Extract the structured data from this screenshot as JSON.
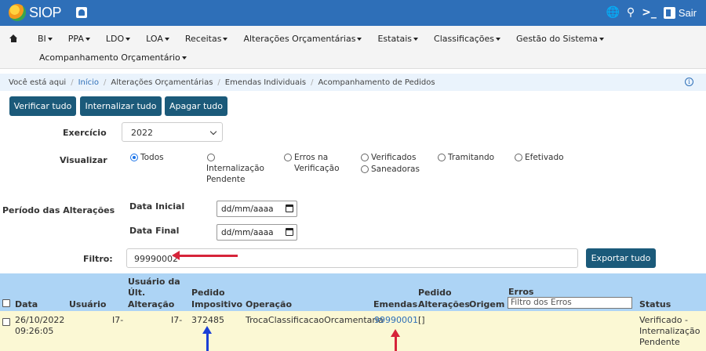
{
  "topbar": {
    "logo_text": "SIOP",
    "exit_label": "Sair",
    "icons": [
      "globe-icon",
      "search-icon",
      "terminal-icon",
      "exit-icon"
    ]
  },
  "menu": {
    "items": [
      "BI",
      "PPA",
      "LDO",
      "LOA",
      "Receitas",
      "Alterações Orçamentárias",
      "Estatais",
      "Classificações",
      "Gestão do Sistema"
    ],
    "second_row": "Acompanhamento Orçamentário"
  },
  "breadcrumb": {
    "prefix": "Você está aqui",
    "items": [
      "Início",
      "Alterações Orçamentárias",
      "Emendas Individuais",
      "Acompanhamento de Pedidos"
    ]
  },
  "actions": {
    "verify_all": "Verificar tudo",
    "internalize_all": "Internalizar tudo",
    "delete_all": "Apagar tudo"
  },
  "form": {
    "exercicio_label": "Exercício",
    "exercicio_value": "2022",
    "visualizar_label": "Visualizar",
    "radios": [
      {
        "label": "Todos",
        "checked": true
      },
      {
        "label": "Internalização Pendente",
        "checked": false
      },
      {
        "label": "Erros na Verificação",
        "checked": false
      },
      {
        "label": "Verificados",
        "checked": false
      },
      {
        "label": "Saneadoras",
        "checked": false
      },
      {
        "label": "Tramitando",
        "checked": false
      },
      {
        "label": "Efetivado",
        "checked": false
      }
    ],
    "periodo_label": "Período das Alterações",
    "data_inicial_label": "Data Inicial",
    "data_final_label": "Data Final",
    "date_placeholder": "dd/mm/aaaa",
    "filtro_label": "Filtro:",
    "filtro_value": "99990002",
    "export_label": "Exportar tudo"
  },
  "table": {
    "headers": {
      "data": "Data",
      "usuario": "Usuário",
      "usuario_ult_1": "Usuário da",
      "usuario_ult_2": "Últ.",
      "usuario_ult_3": "Alteração",
      "pedido_imp_1": "Pedido",
      "pedido_imp_2": "Impositivo",
      "operacao": "Operação",
      "emendas": "Emendas",
      "pedido_alt_1": "Pedido",
      "pedido_alt_2": "Alterações",
      "origem": "Origem",
      "erros": "Erros",
      "erros_placeholder": "Filtro dos Erros",
      "status": "Status"
    },
    "rows": [
      {
        "data_1": "26/10/2022",
        "data_2": "09:26:05",
        "usuario": "I7-",
        "usuario_ult": "I7-",
        "pedido_impositivo": "372485",
        "operacao": "TrocaClassificacaoOrcamentaria",
        "emendas": "99990001",
        "pedido_alteracoes": "[]",
        "status_1": "Verificado -",
        "status_2": "Internalização",
        "status_3": "Pendente"
      }
    ]
  },
  "colors": {
    "topbar": "#2e6fb8",
    "button": "#1b5a7a",
    "table_header": "#add4f5",
    "row_highlight": "#fbf8d4",
    "annotation_red": "#d6243a",
    "annotation_blue": "#1a3fd6"
  }
}
